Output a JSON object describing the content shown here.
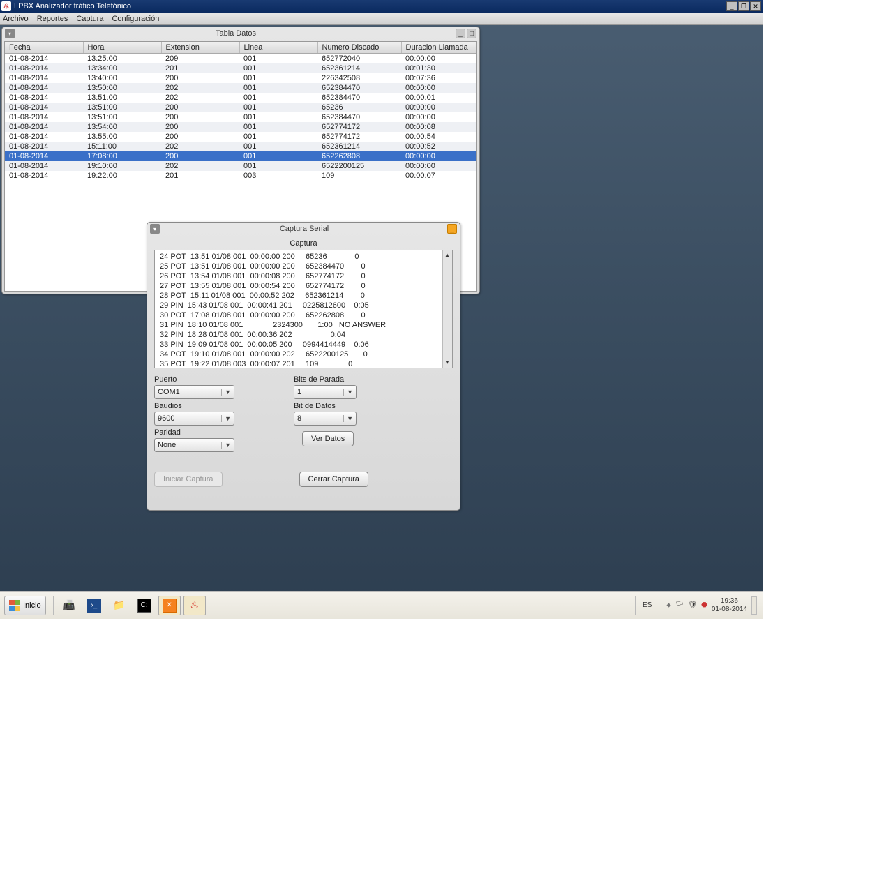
{
  "app": {
    "title": "LPBX Analizador tráfico Telefónico"
  },
  "menu": {
    "archivo": "Archivo",
    "reportes": "Reportes",
    "captura": "Captura",
    "config": "Configuración"
  },
  "tabla": {
    "title": "Tabla Datos",
    "headers": {
      "fecha": "Fecha",
      "hora": "Hora",
      "ext": "Extension",
      "linea": "Linea",
      "numero": "Numero Discado",
      "dur": "Duracion Llamada"
    },
    "rows": [
      {
        "fecha": "01-08-2014",
        "hora": "13:25:00",
        "ext": "209",
        "linea": "001",
        "num": "652772040",
        "dur": "00:00:00"
      },
      {
        "fecha": "01-08-2014",
        "hora": "13:34:00",
        "ext": "201",
        "linea": "001",
        "num": "652361214",
        "dur": "00:01:30"
      },
      {
        "fecha": "01-08-2014",
        "hora": "13:40:00",
        "ext": "200",
        "linea": "001",
        "num": "226342508",
        "dur": "00:07:36"
      },
      {
        "fecha": "01-08-2014",
        "hora": "13:50:00",
        "ext": "202",
        "linea": "001",
        "num": "652384470",
        "dur": "00:00:00"
      },
      {
        "fecha": "01-08-2014",
        "hora": "13:51:00",
        "ext": "202",
        "linea": "001",
        "num": "652384470",
        "dur": "00:00:01"
      },
      {
        "fecha": "01-08-2014",
        "hora": "13:51:00",
        "ext": "200",
        "linea": "001",
        "num": "65236",
        "dur": "00:00:00"
      },
      {
        "fecha": "01-08-2014",
        "hora": "13:51:00",
        "ext": "200",
        "linea": "001",
        "num": "652384470",
        "dur": "00:00:00"
      },
      {
        "fecha": "01-08-2014",
        "hora": "13:54:00",
        "ext": "200",
        "linea": "001",
        "num": "652774172",
        "dur": "00:00:08"
      },
      {
        "fecha": "01-08-2014",
        "hora": "13:55:00",
        "ext": "200",
        "linea": "001",
        "num": "652774172",
        "dur": "00:00:54"
      },
      {
        "fecha": "01-08-2014",
        "hora": "15:11:00",
        "ext": "202",
        "linea": "001",
        "num": "652361214",
        "dur": "00:00:52"
      },
      {
        "fecha": "01-08-2014",
        "hora": "17:08:00",
        "ext": "200",
        "linea": "001",
        "num": "652262808",
        "dur": "00:00:00",
        "selected": true
      },
      {
        "fecha": "01-08-2014",
        "hora": "19:10:00",
        "ext": "202",
        "linea": "001",
        "num": "6522200125",
        "dur": "00:00:00"
      },
      {
        "fecha": "01-08-2014",
        "hora": "19:22:00",
        "ext": "201",
        "linea": "003",
        "num": "109",
        "dur": "00:00:07"
      }
    ]
  },
  "captura": {
    "title": "Captura Serial",
    "label": "Captura",
    "log": " 24 POT  13:51 01/08 001  00:00:00 200     65236             0\n 25 POT  13:51 01/08 001  00:00:00 200     652384470        0\n 26 POT  13:54 01/08 001  00:00:08 200     652774172        0\n 27 POT  13:55 01/08 001  00:00:54 200     652774172        0\n 28 POT  15:11 01/08 001  00:00:52 202     652361214        0\n 29 PIN  15:43 01/08 001  00:00:41 201     0225812600    0:05\n 30 POT  17:08 01/08 001  00:00:00 200     652262808        0\n 31 PIN  18:10 01/08 001              2324300       1:00   NO ANSWER \n 32 PIN  18:28 01/08 001  00:00:36 202                  0:04\n 33 PIN  19:09 01/08 001  00:00:05 200     0994414449    0:06\n 34 POT  19:10 01/08 001  00:00:00 202     6522200125       0\n 35 POT  19:22 01/08 003  00:00:07 201     109              0",
    "puerto_lbl": "Puerto",
    "puerto": "COM1",
    "baudios_lbl": "Baudios",
    "baudios": "9600",
    "paridad_lbl": "Paridad",
    "paridad": "None",
    "bits_parada_lbl": "Bits de Parada",
    "bits_parada": "1",
    "bit_datos_lbl": "Bit de Datos",
    "bit_datos": "8",
    "ver_datos": "Ver Datos",
    "iniciar": "Iniciar Captura",
    "cerrar": "Cerrar Captura"
  },
  "taskbar": {
    "start": "Inicio",
    "lang": "ES",
    "time": "19:36",
    "date": "01-08-2014"
  }
}
